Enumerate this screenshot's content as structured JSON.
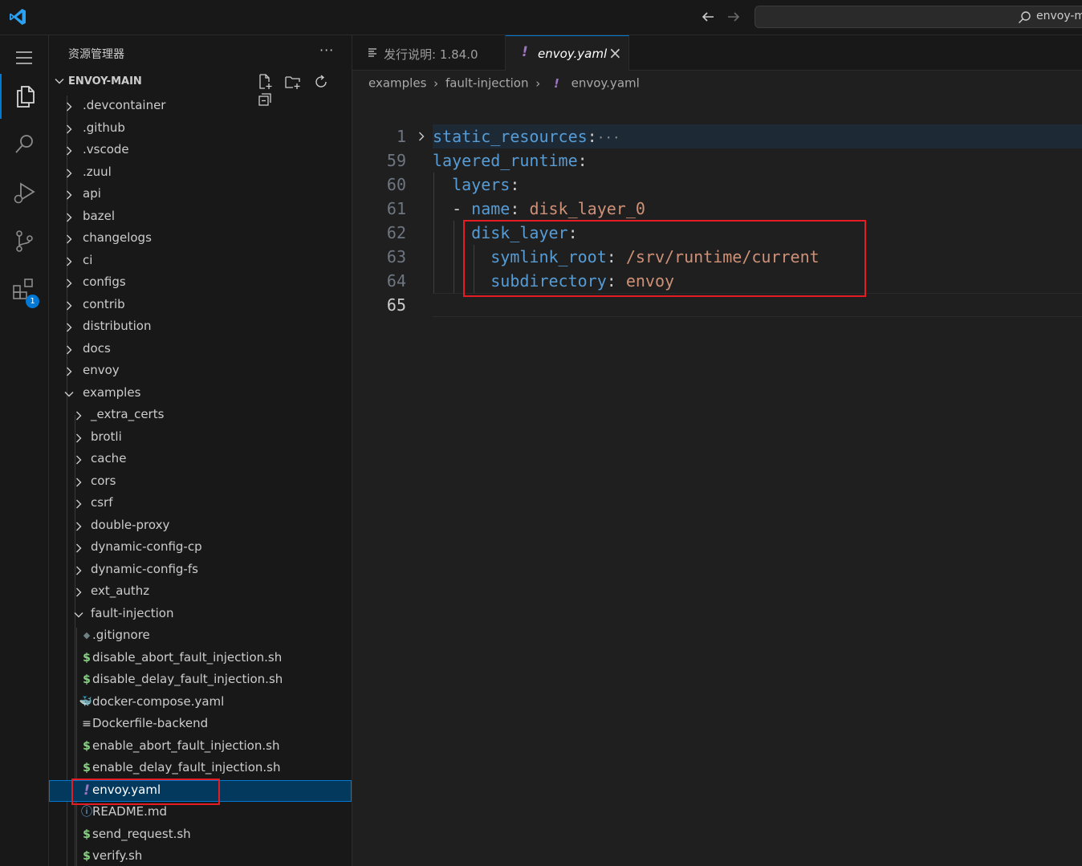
{
  "titlebar": {
    "back_icon": "arrow-left-icon",
    "forward_icon": "arrow-right-icon",
    "command_center_text": "envoy-main"
  },
  "activity_bar": {
    "items": [
      "explorer",
      "search",
      "run-and-debug",
      "source-control",
      "extensions"
    ],
    "extensions_badge": "1"
  },
  "sidebar": {
    "title": "资源管理器",
    "more": "···",
    "section_title": "ENVOY-MAIN",
    "tree": [
      {
        "label": ".devcontainer",
        "type": "folder",
        "depth": 0
      },
      {
        "label": ".github",
        "type": "folder",
        "depth": 0
      },
      {
        "label": ".vscode",
        "type": "folder",
        "depth": 0
      },
      {
        "label": ".zuul",
        "type": "folder",
        "depth": 0
      },
      {
        "label": "api",
        "type": "folder",
        "depth": 0
      },
      {
        "label": "bazel",
        "type": "folder",
        "depth": 0
      },
      {
        "label": "changelogs",
        "type": "folder",
        "depth": 0
      },
      {
        "label": "ci",
        "type": "folder",
        "depth": 0
      },
      {
        "label": "configs",
        "type": "folder",
        "depth": 0
      },
      {
        "label": "contrib",
        "type": "folder",
        "depth": 0
      },
      {
        "label": "distribution",
        "type": "folder",
        "depth": 0
      },
      {
        "label": "docs",
        "type": "folder",
        "depth": 0
      },
      {
        "label": "envoy",
        "type": "folder",
        "depth": 0
      },
      {
        "label": "examples",
        "type": "folder-open",
        "depth": 0
      },
      {
        "label": "_extra_certs",
        "type": "folder",
        "depth": 1
      },
      {
        "label": "brotli",
        "type": "folder",
        "depth": 1
      },
      {
        "label": "cache",
        "type": "folder",
        "depth": 1
      },
      {
        "label": "cors",
        "type": "folder",
        "depth": 1
      },
      {
        "label": "csrf",
        "type": "folder",
        "depth": 1
      },
      {
        "label": "double-proxy",
        "type": "folder",
        "depth": 1
      },
      {
        "label": "dynamic-config-cp",
        "type": "folder",
        "depth": 1
      },
      {
        "label": "dynamic-config-fs",
        "type": "folder",
        "depth": 1
      },
      {
        "label": "ext_authz",
        "type": "folder",
        "depth": 1
      },
      {
        "label": "fault-injection",
        "type": "folder-open",
        "depth": 1
      },
      {
        "label": ".gitignore",
        "type": "git",
        "depth": 2
      },
      {
        "label": "disable_abort_fault_injection.sh",
        "type": "shell",
        "depth": 2
      },
      {
        "label": "disable_delay_fault_injection.sh",
        "type": "shell",
        "depth": 2
      },
      {
        "label": "docker-compose.yaml",
        "type": "docker",
        "depth": 2
      },
      {
        "label": "Dockerfile-backend",
        "type": "text",
        "depth": 2
      },
      {
        "label": "enable_abort_fault_injection.sh",
        "type": "shell",
        "depth": 2
      },
      {
        "label": "enable_delay_fault_injection.sh",
        "type": "shell",
        "depth": 2
      },
      {
        "label": "envoy.yaml",
        "type": "yaml",
        "depth": 2,
        "selected": true
      },
      {
        "label": "README.md",
        "type": "info",
        "depth": 2
      },
      {
        "label": "send_request.sh",
        "type": "shell",
        "depth": 2
      },
      {
        "label": "verify.sh",
        "type": "shell",
        "depth": 2
      }
    ]
  },
  "tabs": [
    {
      "label": "发行说明: 1.84.0",
      "icon": "release-notes-icon",
      "active": false
    },
    {
      "label": "envoy.yaml",
      "icon": "yaml-icon",
      "active": true,
      "close": "×"
    }
  ],
  "breadcrumb": [
    "examples",
    "fault-injection",
    "envoy.yaml"
  ],
  "icons": {
    "yaml_glyph": "!",
    "shell_glyph": "$",
    "chevron_glyph": "›",
    "fold_more": "···"
  },
  "colors": {
    "accent": "#0078d4",
    "yaml_key": "#569cd6",
    "yaml_value": "#ce9178",
    "yaml_icon": "#a074c4",
    "shell_icon": "#89d185",
    "docker_icon": "#e25a6d",
    "highlight_box": "#e51c23"
  },
  "code": [
    {
      "ln": "1",
      "folded": true,
      "tokens": [
        {
          "t": "static_resources",
          "c": "k"
        },
        {
          "t": ":",
          "c": "p"
        }
      ]
    },
    {
      "ln": "59",
      "tokens": [
        {
          "t": "layered_runtime",
          "c": "k"
        },
        {
          "t": ":",
          "c": "p"
        }
      ]
    },
    {
      "ln": "60",
      "tokens": [
        {
          "t": "  ",
          "c": "p"
        },
        {
          "t": "layers",
          "c": "k"
        },
        {
          "t": ":",
          "c": "p"
        }
      ]
    },
    {
      "ln": "61",
      "tokens": [
        {
          "t": "  - ",
          "c": "p"
        },
        {
          "t": "name",
          "c": "k"
        },
        {
          "t": ": ",
          "c": "p"
        },
        {
          "t": "disk_layer_0",
          "c": "v"
        }
      ]
    },
    {
      "ln": "62",
      "tokens": [
        {
          "t": "    ",
          "c": "p"
        },
        {
          "t": "disk_layer",
          "c": "k"
        },
        {
          "t": ":",
          "c": "p"
        }
      ]
    },
    {
      "ln": "63",
      "tokens": [
        {
          "t": "      ",
          "c": "p"
        },
        {
          "t": "symlink_root",
          "c": "k"
        },
        {
          "t": ": ",
          "c": "p"
        },
        {
          "t": "/srv/runtime/current",
          "c": "v"
        }
      ]
    },
    {
      "ln": "64",
      "tokens": [
        {
          "t": "      ",
          "c": "p"
        },
        {
          "t": "subdirectory",
          "c": "k"
        },
        {
          "t": ": ",
          "c": "p"
        },
        {
          "t": "envoy",
          "c": "v"
        }
      ]
    },
    {
      "ln": "65",
      "active": true,
      "tokens": []
    }
  ]
}
